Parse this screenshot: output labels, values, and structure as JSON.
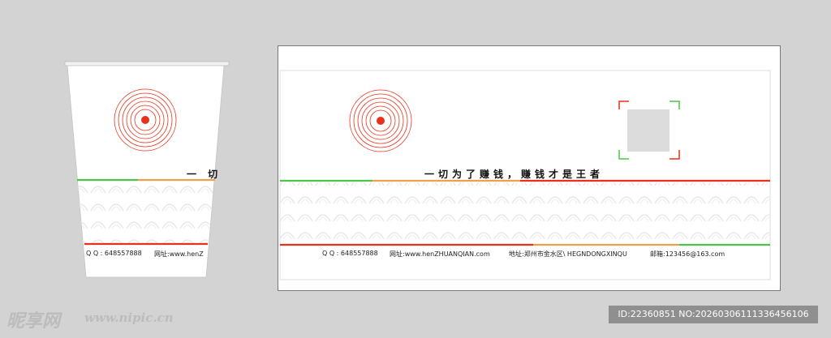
{
  "cup": {
    "slogan": "一 切",
    "qq": "Q Q :  648557888",
    "web": "网址:www.henZ"
  },
  "sheet": {
    "slogan": "一切为了赚钱，赚钱才是王者",
    "qq": "Q Q :  648557888",
    "web": "网址:www.henZHUANQIAN.com",
    "address": "地址:郑州市金水区\\ HEGNDONGXINQU",
    "email": "邮箱:123456@163.com"
  },
  "colors": {
    "red": "#e8311a",
    "orange": "#f0a04b",
    "green": "#4ec34a",
    "background": "#d3d3d3"
  },
  "watermark": {
    "brand": "昵享网",
    "site": "www.nipic.cn",
    "id_text": "ID:22360851 NO:20260306111336456106"
  }
}
